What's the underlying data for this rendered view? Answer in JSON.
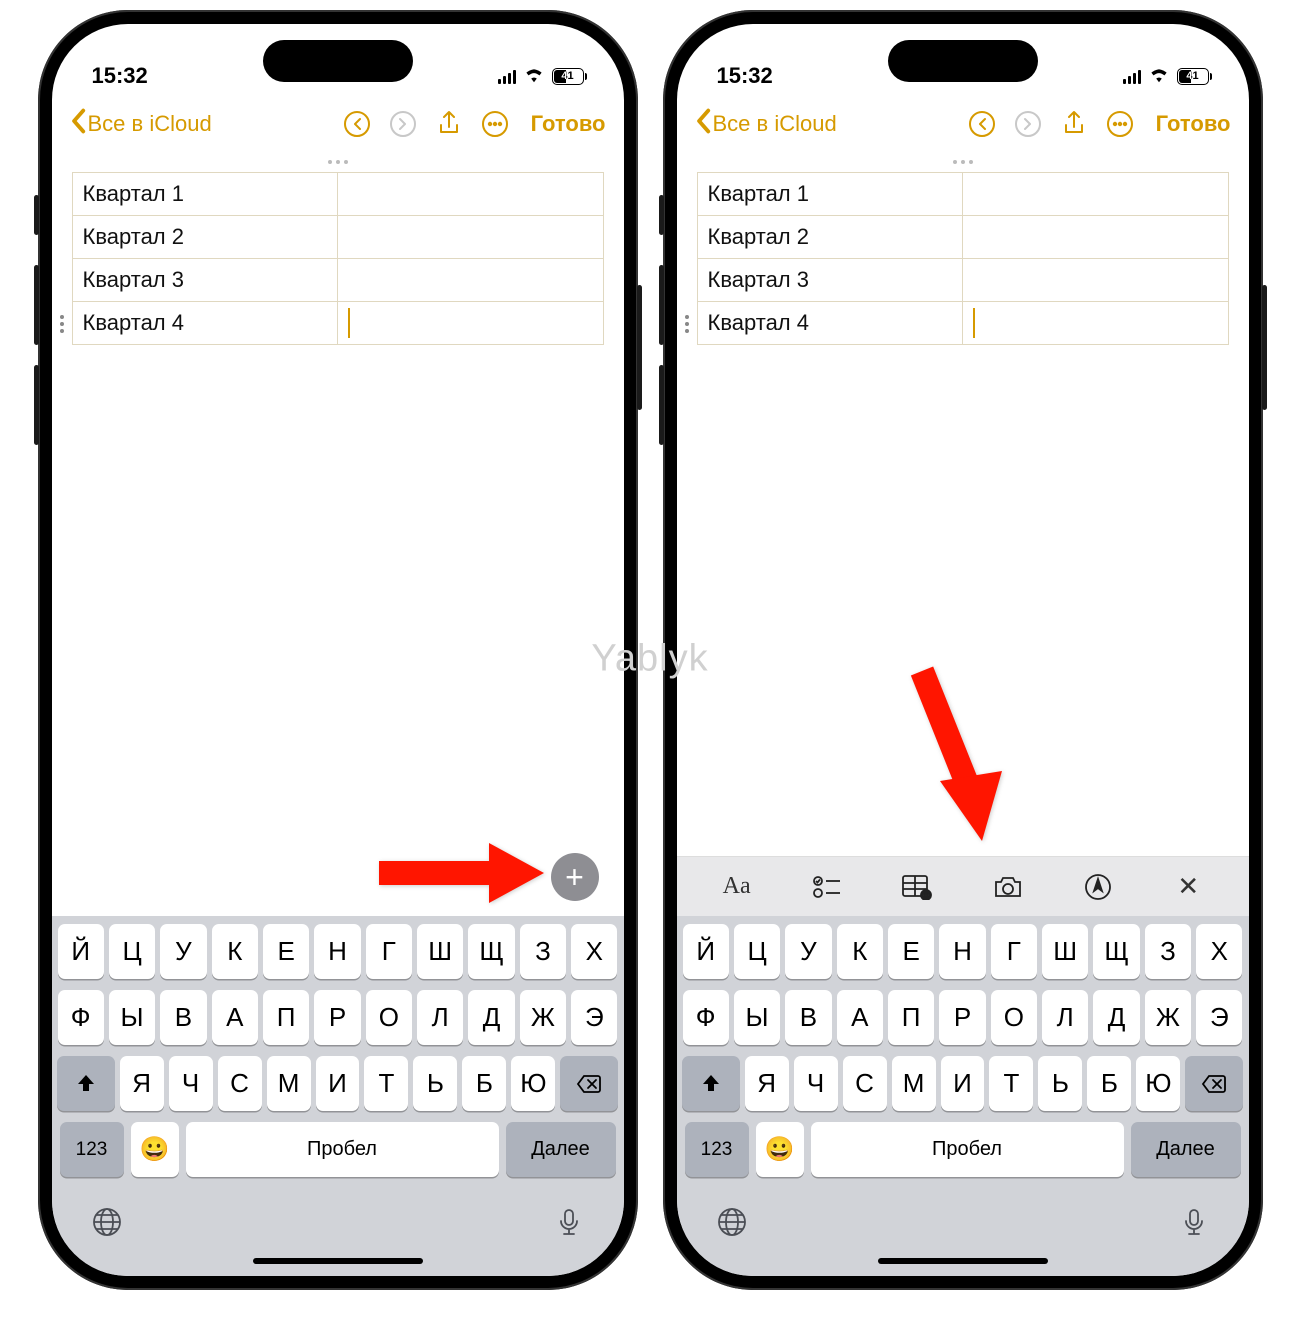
{
  "watermark": "Yablyk",
  "status": {
    "time": "15:32",
    "battery_pct": "41",
    "battery_fill_pct": 41
  },
  "nav": {
    "back_label": "Все в iCloud",
    "done_label": "Готово"
  },
  "table": {
    "rows": [
      {
        "c1": "Квартал 1",
        "c2": ""
      },
      {
        "c1": "Квартал 2",
        "c2": ""
      },
      {
        "c1": "Квартал 3",
        "c2": ""
      },
      {
        "c1": "Квартал 4",
        "c2": ""
      }
    ],
    "active_row_index": 3
  },
  "format_bar": {
    "aa": "Aa"
  },
  "keyboard": {
    "row1": [
      "Й",
      "Ц",
      "У",
      "К",
      "Е",
      "Н",
      "Г",
      "Ш",
      "Щ",
      "З",
      "Х"
    ],
    "row2": [
      "Ф",
      "Ы",
      "В",
      "А",
      "П",
      "Р",
      "О",
      "Л",
      "Д",
      "Ж",
      "Э"
    ],
    "row3": [
      "Я",
      "Ч",
      "С",
      "М",
      "И",
      "Т",
      "Ь",
      "Б",
      "Ю"
    ],
    "num_key": "123",
    "space_label": "Пробел",
    "next_label": "Далее"
  }
}
